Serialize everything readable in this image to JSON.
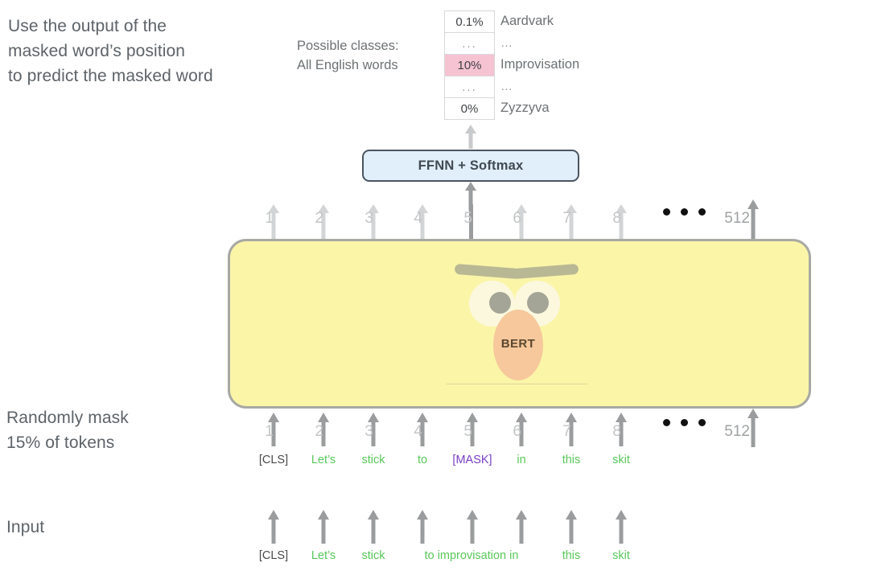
{
  "captions": {
    "predict": "Use the output of the\nmasked word’s position\nto predict the masked word",
    "mask": "Randomly mask\n15% of tokens",
    "input": "Input"
  },
  "output": {
    "possible_classes_label": "Possible classes:\nAll English words",
    "rows": [
      {
        "prob": "0.1%",
        "class": "Aardvark",
        "highlight": false,
        "ellipsis": false
      },
      {
        "prob": "...",
        "class": "…",
        "highlight": false,
        "ellipsis": true
      },
      {
        "prob": "10%",
        "class": "Improvisation",
        "highlight": true,
        "ellipsis": false
      },
      {
        "prob": "...",
        "class": "…",
        "highlight": false,
        "ellipsis": true
      },
      {
        "prob": "0%",
        "class": "Zyzzyva",
        "highlight": false,
        "ellipsis": false
      }
    ],
    "highlight_color": "#f6c3d3"
  },
  "ffnn": {
    "label": "FFNN + Softmax",
    "fill_color": "#e0effa",
    "border_color": "#4a5560"
  },
  "model": {
    "name": "BERT",
    "box_color": "#fbf5a8",
    "box_border_color": "#a8a9a3"
  },
  "top_row": {
    "positions": [
      "1",
      "2",
      "3",
      "4",
      "5",
      "6",
      "7",
      "8",
      "512"
    ],
    "active_position": "5",
    "ellipsis": "• • •"
  },
  "masked_row": {
    "positions": [
      "1",
      "2",
      "3",
      "4",
      "5",
      "6",
      "7",
      "8",
      "512"
    ],
    "tokens": [
      {
        "text": "[CLS]",
        "color": "gray"
      },
      {
        "text": "Let’s",
        "color": "green"
      },
      {
        "text": "stick",
        "color": "green"
      },
      {
        "text": "to",
        "color": "green"
      },
      {
        "text": "[MASK]",
        "color": "purple"
      },
      {
        "text": "in",
        "color": "green"
      },
      {
        "text": "this",
        "color": "green"
      },
      {
        "text": "skit",
        "color": "green"
      }
    ],
    "ellipsis": "• • •"
  },
  "input_row": {
    "tokens": [
      {
        "text": "[CLS]",
        "color": "gray"
      },
      {
        "text": "Let’s",
        "color": "green"
      },
      {
        "text": "stick",
        "color": "green"
      },
      {
        "text": "to improvisation in",
        "color": "green"
      },
      {
        "text": "this",
        "color": "green"
      },
      {
        "text": "skit",
        "color": "green"
      }
    ]
  },
  "colors": {
    "token_green": "#58c75a",
    "token_purple": "#7a3fc4",
    "arrow_light": "#c9cacb",
    "arrow_dark": "#9a9c9d"
  }
}
